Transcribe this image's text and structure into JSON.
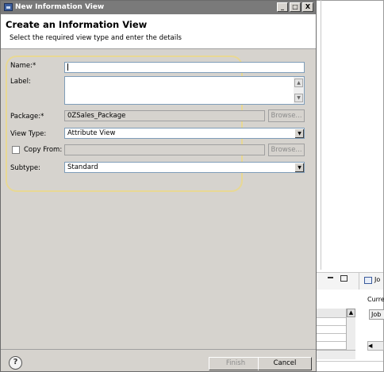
{
  "dialog": {
    "title": "New Information View",
    "window_buttons": {
      "minimize": "_",
      "maximize": "□",
      "close": "X"
    },
    "header_title": "Create an Information View",
    "header_description": "Select the required view type and enter the details"
  },
  "form": {
    "name_label": "Name:*",
    "name_value": "",
    "label_label": "Label:",
    "label_value": "",
    "package_label": "Package:*",
    "package_value": "0ZSales_Package",
    "package_browse": "Browse...",
    "view_type_label": "View Type:",
    "view_type_value": "Attribute View",
    "copy_from_label": "Copy From:",
    "copy_from_checked": false,
    "copy_from_value": "",
    "copy_from_browse": "Browse...",
    "subtype_label": "Subtype:",
    "subtype_value": "Standard"
  },
  "footer": {
    "help": "?",
    "finish": "Finish",
    "cancel": "Cancel"
  },
  "background_app": {
    "tab_label": "Jo",
    "current_label": "Curre",
    "job_button": "Job"
  },
  "colors": {
    "titlebar": "#7a7a7a",
    "dialog_bg": "#d6d3ce",
    "highlight": "#e8d894"
  }
}
